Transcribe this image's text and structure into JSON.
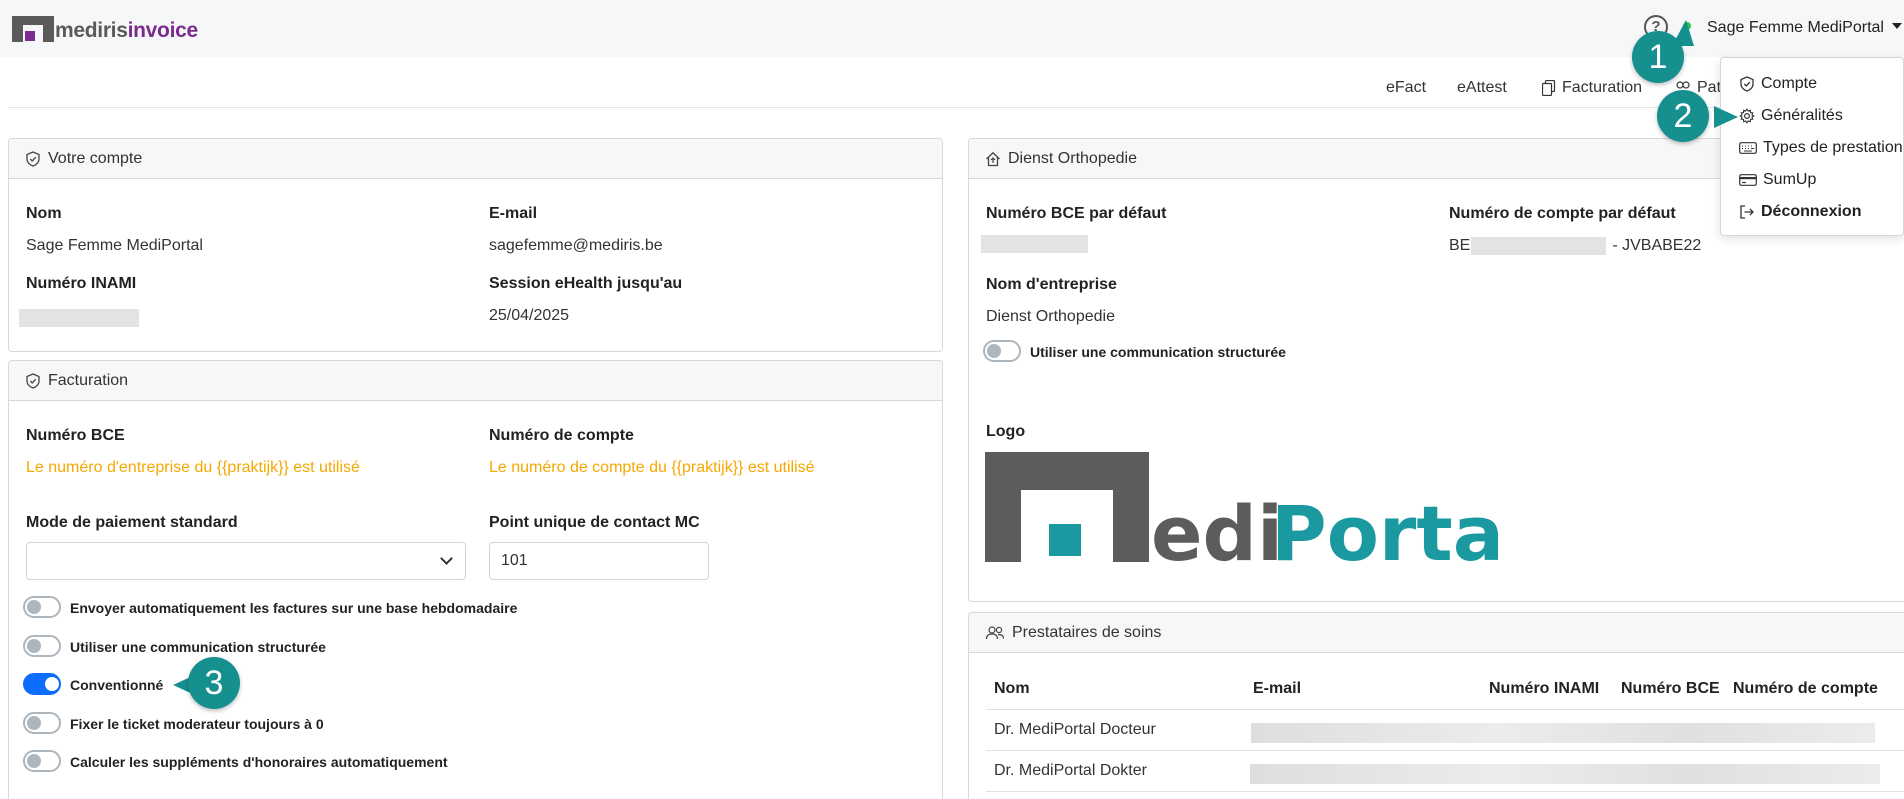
{
  "app": {
    "logo_main": "mediris",
    "logo_accent": "invoice"
  },
  "topbar": {
    "user_name": "Sage Femme MediPortal"
  },
  "nav": {
    "efact": "eFact",
    "eattest": "eAttest",
    "facturation": "Facturation",
    "patients_partial": "Pati"
  },
  "account_card": {
    "title": "Votre compte",
    "name_label": "Nom",
    "name_value": "Sage Femme MediPortal",
    "email_label": "E-mail",
    "email_value": "sagefemme@mediris.be",
    "inami_label": "Numéro INAMI",
    "session_label": "Session eHealth jusqu'au",
    "session_value": "25/04/2025"
  },
  "billing_card": {
    "title": "Facturation",
    "bce_label": "Numéro BCE",
    "bce_warning": "Le numéro d'entreprise du {{praktijk}} est utilisé",
    "account_label": "Numéro de compte",
    "account_warning": "Le numéro de compte du {{praktijk}} est utilisé",
    "payment_label": "Mode de paiement standard",
    "payment_value": "",
    "contact_label": "Point unique de contact MC",
    "contact_value": "101",
    "toggles": [
      {
        "label": "Envoyer automatiquement les factures sur une base hebdomadaire",
        "on": false
      },
      {
        "label": "Utiliser une communication structurée",
        "on": false
      },
      {
        "label": "Conventionné",
        "on": true
      },
      {
        "label": "Fixer le ticket moderateur toujours à 0",
        "on": false
      },
      {
        "label": "Calculer les suppléments d'honoraires automatiquement",
        "on": false
      }
    ]
  },
  "practice_card": {
    "title": "Dienst Orthopedie",
    "bce_label": "Numéro BCE par défaut",
    "account_label": "Numéro de compte par défaut",
    "account_prefix": "BE",
    "account_suffix": "- JVBABE22",
    "company_label": "Nom d'entreprise",
    "company_value": "Dienst Orthopedie",
    "structured_label": "Utiliser une communication structurée",
    "logo_label": "Logo",
    "logo_text_a": "edi",
    "logo_text_b": "Portal"
  },
  "providers_card": {
    "title": "Prestataires de soins",
    "columns": [
      "Nom",
      "E-mail",
      "Numéro INAMI",
      "Numéro BCE",
      "Numéro de compte"
    ],
    "rows": [
      {
        "name": "Dr. MediPortal Docteur"
      },
      {
        "name": "Dr. MediPortal Dokter"
      }
    ]
  },
  "user_menu": {
    "items": [
      "Compte",
      "Généralités",
      "Types de prestation",
      "SumUp",
      "Déconnexion"
    ]
  },
  "badges": [
    "1",
    "2",
    "3"
  ],
  "colors": {
    "accent": "#168f8f",
    "logo_purple": "#7b2b8f",
    "warning": "#f5a800",
    "toggle_on": "#0d6efd"
  }
}
